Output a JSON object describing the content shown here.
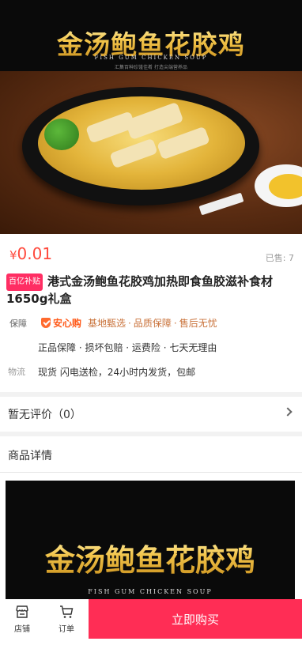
{
  "hero": {
    "title": "金汤鲍鱼花胶鸡",
    "subtitle": "FISH GUM CHICKEN SOUP",
    "small_text": "汇集百种珍馐佳肴 打造尖端营养品"
  },
  "product": {
    "price_currency": "¥",
    "price": "0.01",
    "sold": "已售: 7",
    "tag": "百亿补贴",
    "title": "港式金汤鲍鱼花胶鸡加热即食鱼胶滋补食材1650g礼盒"
  },
  "guarantee": {
    "label": "保障",
    "brand": "安心购",
    "items": [
      "基地甄选",
      "品质保障",
      "售后无忧"
    ],
    "line2": "正品保障 · 损坏包赔 · 运费险 · 七天无理由"
  },
  "shipping": {
    "label": "物流",
    "text": "现货 闪电送检，24小时内发货，包邮"
  },
  "review": {
    "text": "暂无评价（0）"
  },
  "detail": {
    "heading": "商品详情",
    "image_title": "金汤鲍鱼花胶鸡",
    "image_subtitle": "FISH GUM CHICKEN SOUP"
  },
  "bottom_bar": {
    "store_label": "店铺",
    "order_label": "订单",
    "buy_label": "立即购买"
  },
  "colors": {
    "price": "#ff4a3d",
    "buy_button": "#ff2d55",
    "tag": "#ff2e63",
    "guarantee_text": "#c9723a"
  }
}
